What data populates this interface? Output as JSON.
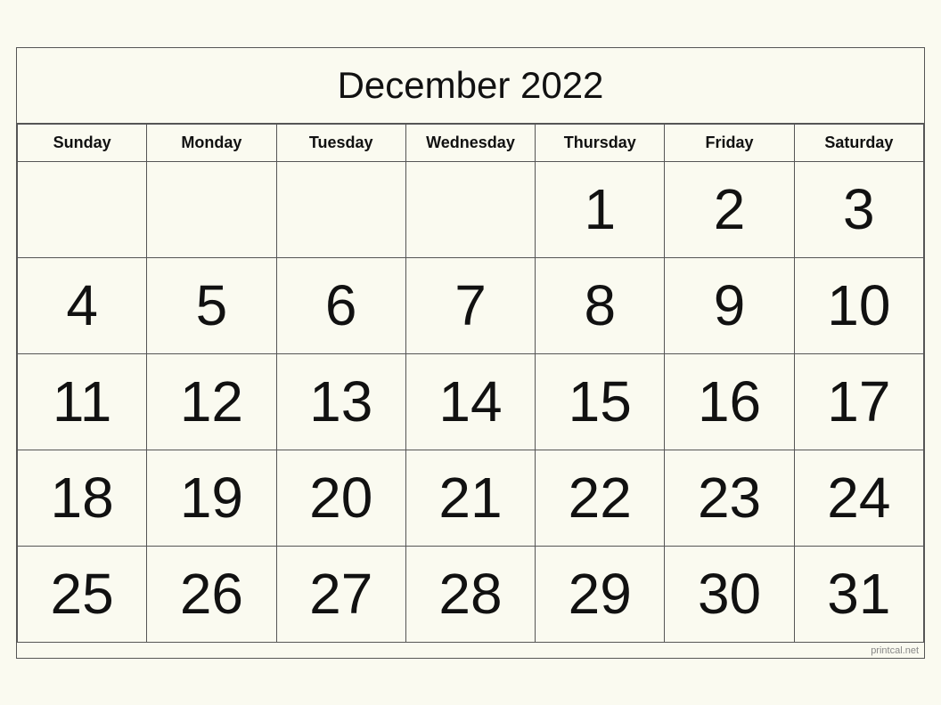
{
  "calendar": {
    "title": "December 2022",
    "days_of_week": [
      "Sunday",
      "Monday",
      "Tuesday",
      "Wednesday",
      "Thursday",
      "Friday",
      "Saturday"
    ],
    "weeks": [
      [
        "",
        "",
        "",
        "",
        "1",
        "2",
        "3"
      ],
      [
        "4",
        "5",
        "6",
        "7",
        "8",
        "9",
        "10"
      ],
      [
        "11",
        "12",
        "13",
        "14",
        "15",
        "16",
        "17"
      ],
      [
        "18",
        "19",
        "20",
        "21",
        "22",
        "23",
        "24"
      ],
      [
        "25",
        "26",
        "27",
        "28",
        "29",
        "30",
        "31"
      ]
    ],
    "watermark": "printcal.net"
  }
}
